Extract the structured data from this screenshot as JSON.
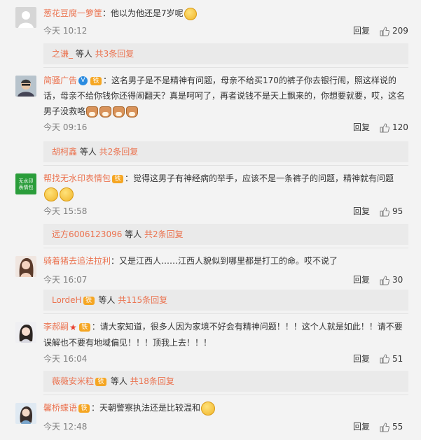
{
  "comments": [
    {
      "user": "葱花豆腐一箩筐",
      "text": "：他以为他还是7岁呢",
      "time": "今天 10:12",
      "reply": "回复",
      "likes": "209",
      "replies": {
        "user": "之谦_",
        "mid": " 等人 ",
        "count": "共3条回复"
      }
    },
    {
      "user": "简骚广告",
      "text_lines": [
        "：这名男子是不是精神有问题，母亲不给买170的裤子你去银行闹，照这样说的",
        "话，母亲不给你钱你还得闹翻天？真是呵呵了，再者说钱不是天上飘来的，你想要就要，哎，这名",
        "男子没救咯"
      ],
      "time": "今天 09:16",
      "reply": "回复",
      "likes": "120",
      "replies": {
        "user": "胡柯鑫",
        "mid": " 等人 ",
        "count": "共2条回复"
      }
    },
    {
      "user": "帮找无水印表情包",
      "text": "：觉得这男子有神经病的举手，应该不是一条裤子的问题，精神就有问题",
      "avatar_text": [
        "无水印",
        "表情包"
      ],
      "time": "今天 15:58",
      "reply": "回复",
      "likes": "95",
      "replies": {
        "user": "远方6006123096",
        "mid": " 等人 ",
        "count": "共2条回复"
      }
    },
    {
      "user": "骑着猪去追法拉利",
      "text": "：又是江西人……江西人貌似到哪里都是打工的命。哎不说了",
      "time": "今天 16:07",
      "reply": "回复",
      "likes": "30",
      "replies": {
        "user": "LordeH",
        "mid": " 等人 ",
        "count": "共115条回复"
      }
    },
    {
      "user": "李郝嗣",
      "text_lines": [
        "：请大家知道，很多人因为家境不好会有精神问题！！！这个人就是如此！！请不要",
        "误解也不要有地域偏见！！！顶我上去！！！"
      ],
      "time": "今天 16:04",
      "reply": "回复",
      "likes": "51",
      "replies": {
        "user": "薇薇安米粒",
        "mid": " 等人 ",
        "count": "共18条回复"
      }
    },
    {
      "user": "馨桥蝶语",
      "text": "：天朝警察执法还是比较温和",
      "time": "今天 12:48",
      "reply": "回复",
      "likes": "55"
    }
  ],
  "icons": {
    "thumb": "thumbs-up-icon",
    "avatar_default": "default-avatar-icon"
  },
  "colors": {
    "username": "#eb7350",
    "badge": "#f5a623",
    "vip": "#2a8be0",
    "bg": "#f3f3f3"
  }
}
